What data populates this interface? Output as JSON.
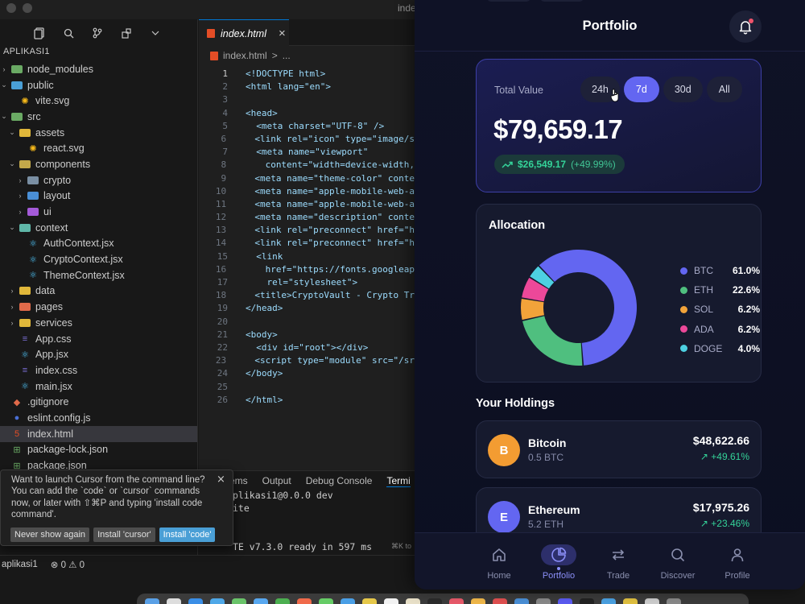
{
  "editor": {
    "title": "inde",
    "explorer_root": "APLIKASI1",
    "tree": [
      {
        "label": "node_modules",
        "type": "folder",
        "expanded": false,
        "depth": 0,
        "color": "#6aaa64"
      },
      {
        "label": "public",
        "type": "folder",
        "expanded": true,
        "depth": 0,
        "color": "#4a9fd6"
      },
      {
        "label": "vite.svg",
        "type": "file",
        "depth": 1,
        "color": "#f5b81a",
        "glyph": "✺"
      },
      {
        "label": "src",
        "type": "folder",
        "expanded": true,
        "depth": 0,
        "color": "#6aaa64"
      },
      {
        "label": "assets",
        "type": "folder",
        "expanded": true,
        "depth": 1,
        "color": "#e0b73a"
      },
      {
        "label": "react.svg",
        "type": "file",
        "depth": 2,
        "color": "#f5b81a",
        "glyph": "✺"
      },
      {
        "label": "components",
        "type": "folder",
        "expanded": true,
        "depth": 1,
        "color": "#c3a84a"
      },
      {
        "label": "crypto",
        "type": "folder",
        "expanded": false,
        "depth": 2,
        "color": "#7a8fa3"
      },
      {
        "label": "layout",
        "type": "folder",
        "expanded": false,
        "depth": 2,
        "color": "#4a8fd6"
      },
      {
        "label": "ui",
        "type": "folder",
        "expanded": false,
        "depth": 2,
        "color": "#a45ad8"
      },
      {
        "label": "context",
        "type": "folder",
        "expanded": true,
        "depth": 1,
        "color": "#5fb7a8"
      },
      {
        "label": "AuthContext.jsx",
        "type": "file",
        "depth": 2,
        "color": "#4fc3f7",
        "glyph": "⚛"
      },
      {
        "label": "CryptoContext.jsx",
        "type": "file",
        "depth": 2,
        "color": "#4fc3f7",
        "glyph": "⚛"
      },
      {
        "label": "ThemeContext.jsx",
        "type": "file",
        "depth": 2,
        "color": "#4fc3f7",
        "glyph": "⚛"
      },
      {
        "label": "data",
        "type": "folder",
        "expanded": false,
        "depth": 1,
        "color": "#e0b73a"
      },
      {
        "label": "pages",
        "type": "folder",
        "expanded": false,
        "depth": 1,
        "color": "#e06a4a"
      },
      {
        "label": "services",
        "type": "folder",
        "expanded": false,
        "depth": 1,
        "color": "#e0b73a"
      },
      {
        "label": "App.css",
        "type": "file",
        "depth": 1,
        "color": "#7b6fd6",
        "glyph": "≡"
      },
      {
        "label": "App.jsx",
        "type": "file",
        "depth": 1,
        "color": "#4fc3f7",
        "glyph": "⚛"
      },
      {
        "label": "index.css",
        "type": "file",
        "depth": 1,
        "color": "#7b6fd6",
        "glyph": "≡"
      },
      {
        "label": "main.jsx",
        "type": "file",
        "depth": 1,
        "color": "#4fc3f7",
        "glyph": "⚛"
      },
      {
        "label": ".gitignore",
        "type": "file",
        "depth": 0,
        "color": "#e06a4a",
        "glyph": "◆"
      },
      {
        "label": "eslint.config.js",
        "type": "file",
        "depth": 0,
        "color": "#4a6fd6",
        "glyph": "●"
      },
      {
        "label": "index.html",
        "type": "file",
        "depth": 0,
        "color": "#e44d26",
        "glyph": "5",
        "active": true
      },
      {
        "label": "package-lock.json",
        "type": "file",
        "depth": 0,
        "color": "#6aaa64",
        "glyph": "⊞"
      },
      {
        "label": "package.json",
        "type": "file",
        "depth": 0,
        "color": "#6aaa64",
        "glyph": "⊞"
      }
    ],
    "tab_label": "index.html",
    "tab_close": "×",
    "breadcrumb_file": "index.html",
    "breadcrumb_sep": ">",
    "breadcrumb_more": "...",
    "code_lines": [
      {
        "n": "1",
        "t": "<!DOCTYPE html>"
      },
      {
        "n": "2",
        "t": "<html lang=\"en\">"
      },
      {
        "n": "3",
        "t": ""
      },
      {
        "n": "4",
        "t": "<head>"
      },
      {
        "n": "5",
        "t": "  <meta charset=\"UTF-8\" />"
      },
      {
        "n": "6",
        "t": "  <link rel=\"icon\" type=\"image/s"
      },
      {
        "n": "7",
        "t": "  <meta name=\"viewport\""
      },
      {
        "n": "8",
        "t": "    content=\"width=device-width,"
      },
      {
        "n": "9",
        "t": "  <meta name=\"theme-color\" conte"
      },
      {
        "n": "10",
        "t": "  <meta name=\"apple-mobile-web-a"
      },
      {
        "n": "11",
        "t": "  <meta name=\"apple-mobile-web-a"
      },
      {
        "n": "12",
        "t": "  <meta name=\"description\" conte"
      },
      {
        "n": "13",
        "t": "  <link rel=\"preconnect\" href=\"h"
      },
      {
        "n": "14",
        "t": "  <link rel=\"preconnect\" href=\"h"
      },
      {
        "n": "15",
        "t": "  <link"
      },
      {
        "n": "16",
        "t": "    href=\"https://fonts.googleap"
      },
      {
        "n": "17",
        "t": "    rel=\"stylesheet\">"
      },
      {
        "n": "18",
        "t": "  <title>CryptoVault - Crypto Tr"
      },
      {
        "n": "19",
        "t": "</head>"
      },
      {
        "n": "20",
        "t": ""
      },
      {
        "n": "21",
        "t": "<body>"
      },
      {
        "n": "22",
        "t": "  <div id=\"root\"></div>"
      },
      {
        "n": "23",
        "t": "  <script type=\"module\" src=\"/sr"
      },
      {
        "n": "24",
        "t": "</body>"
      },
      {
        "n": "25",
        "t": ""
      },
      {
        "n": "26",
        "t": "</html>"
      }
    ],
    "panel_tabs": [
      "ems",
      "Output",
      "Debug Console",
      "Termi"
    ],
    "terminal_lines": [
      "plikasi1@0.0.0 dev",
      "ite",
      "",
      "",
      "TE v7.3.0  ready in 597 ms"
    ],
    "terminal_hint": "⌘K to",
    "status_items": [
      "aplikasi1",
      "⊗ 0 ⚠ 0"
    ],
    "notification": {
      "message": "Want to launch Cursor from the command line? You can add the `code` or `cursor` commands now, or later with ⇧⌘P and typing 'install code command'.",
      "close": "×",
      "buttons": [
        "Never show again",
        "Install 'cursor'",
        "Install 'code'"
      ]
    }
  },
  "app": {
    "title": "Portfolio",
    "total_value_label": "Total Value",
    "ranges": [
      "24h",
      "7d",
      "30d",
      "All"
    ],
    "active_range": "7d",
    "total_value": "$79,659.17",
    "change_amount": "$26,549.17",
    "change_percent": "(+49.99%)",
    "allocation_title": "Allocation",
    "holdings_title": "Your Holdings",
    "holdings": [
      {
        "initial": "B",
        "name": "Bitcoin",
        "amount": "0.5 BTC",
        "value": "$48,622.66",
        "change": "↗ +49.61%",
        "color": "#f39c32"
      },
      {
        "initial": "E",
        "name": "Ethereum",
        "amount": "5.2 ETH",
        "value": "$17,975.26",
        "change": "↗ +23.46%",
        "color": "#6366f1"
      }
    ],
    "nav": [
      {
        "label": "Home",
        "icon": "home-icon"
      },
      {
        "label": "Portfolio",
        "icon": "pie-chart-icon",
        "active": true
      },
      {
        "label": "Trade",
        "icon": "swap-arrows-icon"
      },
      {
        "label": "Discover",
        "icon": "search-icon"
      },
      {
        "label": "Profile",
        "icon": "user-icon"
      }
    ]
  },
  "chart_data": {
    "type": "pie",
    "title": "Allocation",
    "categories": [
      "BTC",
      "ETH",
      "SOL",
      "ADA",
      "DOGE"
    ],
    "values": [
      61.0,
      22.6,
      6.2,
      6.2,
      4.0
    ],
    "labels": [
      "61.0%",
      "22.6%",
      "6.2%",
      "6.2%",
      "4.0%"
    ],
    "colors": [
      "#6366f1",
      "#4fbf7f",
      "#f2a33a",
      "#ec4899",
      "#4dd0e1"
    ],
    "donut": true,
    "legend": "right"
  }
}
